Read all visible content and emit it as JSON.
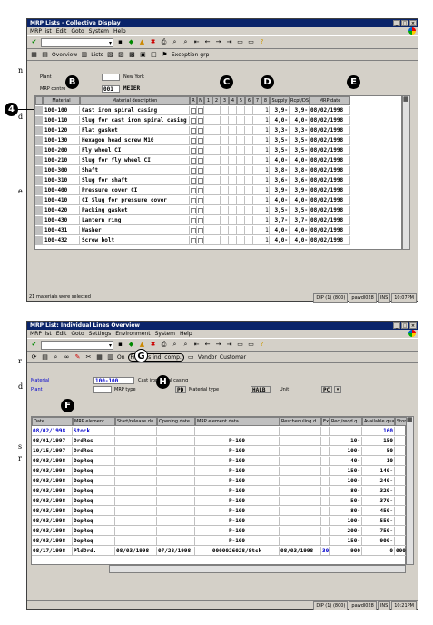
{
  "margin_letters": [
    "n",
    "d",
    "e",
    "r",
    "d",
    "s",
    "r"
  ],
  "window1": {
    "title": "MRP Lists - Collective Display",
    "menu": [
      "MRP list",
      "Edit",
      "Goto",
      "System",
      "Help"
    ],
    "app_toolbar": [
      "Overview",
      "Lists",
      "Exception grp"
    ],
    "header_fields": {
      "plant_label": "Plant",
      "plant_value": "3000",
      "plant_name": "New York",
      "controller_label": "MRP contro",
      "controller_value": "001",
      "controller_name": "MEIER"
    },
    "columns": [
      "Material",
      "Material description",
      "R",
      "N",
      "1",
      "2",
      "3",
      "4",
      "5",
      "6",
      "7",
      "8",
      "Supply",
      "Rcpt/DS",
      "MRP date"
    ],
    "rows": [
      {
        "material": "100-100",
        "description": "Cast iron spiral casing",
        "n": "1",
        "supply": "3,9-",
        "rcpt": "3,9-",
        "date": "08/02/1998"
      },
      {
        "material": "100-110",
        "description": "Slug for cast iron spiral casing",
        "n": "1",
        "supply": "4,0-",
        "rcpt": "4,0-",
        "date": "08/02/1998"
      },
      {
        "material": "100-120",
        "description": "Flat gasket",
        "n": "1",
        "supply": "3,3-",
        "rcpt": "3,3-",
        "date": "08/02/1998"
      },
      {
        "material": "100-130",
        "description": "Hexagon head screw M10",
        "n": "1",
        "supply": "3,5-",
        "rcpt": "3,5-",
        "date": "08/02/1998"
      },
      {
        "material": "100-200",
        "description": "Fly wheel CI",
        "n": "1",
        "supply": "3,5-",
        "rcpt": "3,5-",
        "date": "08/02/1998"
      },
      {
        "material": "100-210",
        "description": "Slug for fly wheel CI",
        "n": "1",
        "supply": "4,0-",
        "rcpt": "4,0-",
        "date": "08/02/1998"
      },
      {
        "material": "100-300",
        "description": "Shaft",
        "n": "1",
        "supply": "3,8-",
        "rcpt": "3,8-",
        "date": "08/02/1998"
      },
      {
        "material": "100-310",
        "description": "Slug for shaft",
        "n": "1",
        "supply": "3,6-",
        "rcpt": "3,6-",
        "date": "08/02/1998"
      },
      {
        "material": "100-400",
        "description": "Pressure cover CI",
        "n": "1",
        "supply": "3,9-",
        "rcpt": "3,9-",
        "date": "08/02/1998"
      },
      {
        "material": "100-410",
        "description": "CI Slug for pressure cover",
        "n": "1",
        "supply": "4,0-",
        "rcpt": "4,0-",
        "date": "08/02/1998"
      },
      {
        "material": "100-420",
        "description": "Packing gasket",
        "n": "1",
        "supply": "3,5-",
        "rcpt": "3,5-",
        "date": "08/02/1998"
      },
      {
        "material": "100-430",
        "description": "Lantern ring",
        "n": "1",
        "supply": "3,7-",
        "rcpt": "3,7-",
        "date": "08/02/1998"
      },
      {
        "material": "100-431",
        "description": "Washer",
        "n": "1",
        "supply": "4,0-",
        "rcpt": "4,0-",
        "date": "08/02/1998"
      },
      {
        "material": "100-432",
        "description": "Screw bolt",
        "n": "1",
        "supply": "4,0-",
        "rcpt": "4,0-",
        "date": "08/02/1998"
      }
    ],
    "status_msg": "21 materials were selected",
    "status_cells": [
      "DIP (1) (800)",
      "pawdl028",
      "INS",
      "10:07PM"
    ]
  },
  "window2": {
    "title": "MRP List: Individual Lines Overview",
    "menu": [
      "MRP list",
      "Edit",
      "Goto",
      "Settings",
      "Environment",
      "System",
      "Help"
    ],
    "app_toolbar": [
      "On",
      "Process ind. comp.",
      "Vendor",
      "Customer"
    ],
    "fields": {
      "material_label": "Material",
      "material_value": "100-100",
      "material_desc": "Cast iron spiral casing",
      "plant_label": "Plant",
      "plant_value": "3000",
      "mrp_type_label": "MRP type",
      "mrp_type_value": "PD",
      "mat_type_label": "Material type",
      "mat_type_value": "HALB",
      "unit_label": "Unit",
      "unit_value": "PC"
    },
    "columns": [
      "Date",
      "MRP element",
      "Start/release da",
      "Opening date",
      "MRP element data",
      "Rescheduling d",
      "Ex",
      "Rec./reqd q",
      "Available qua",
      "Stora"
    ],
    "rows": [
      {
        "date": "08/02/1998",
        "elem": "Stock",
        "start": "",
        "open": "",
        "data": "",
        "resched": "",
        "ex": "",
        "req": "",
        "avail": "160",
        "stor": ""
      },
      {
        "date": "08/01/1997",
        "elem": "OrdRes",
        "start": "",
        "open": "",
        "data": "P-100",
        "resched": "",
        "ex": "",
        "req": "10-",
        "avail": "150",
        "stor": ""
      },
      {
        "date": "10/15/1997",
        "elem": "OrdRes",
        "start": "",
        "open": "",
        "data": "P-100",
        "resched": "",
        "ex": "",
        "req": "100-",
        "avail": "50",
        "stor": ""
      },
      {
        "date": "08/03/1998",
        "elem": "DepReq",
        "start": "",
        "open": "",
        "data": "P-100",
        "resched": "",
        "ex": "",
        "req": "40-",
        "avail": "10",
        "stor": ""
      },
      {
        "date": "08/03/1998",
        "elem": "DepReq",
        "start": "",
        "open": "",
        "data": "P-100",
        "resched": "",
        "ex": "",
        "req": "150-",
        "avail": "140-",
        "stor": ""
      },
      {
        "date": "08/03/1998",
        "elem": "DepReq",
        "start": "",
        "open": "",
        "data": "P-100",
        "resched": "",
        "ex": "",
        "req": "100-",
        "avail": "240-",
        "stor": ""
      },
      {
        "date": "08/03/1998",
        "elem": "DepReq",
        "start": "",
        "open": "",
        "data": "P-100",
        "resched": "",
        "ex": "",
        "req": "80-",
        "avail": "320-",
        "stor": ""
      },
      {
        "date": "08/03/1998",
        "elem": "DepReq",
        "start": "",
        "open": "",
        "data": "P-100",
        "resched": "",
        "ex": "",
        "req": "50-",
        "avail": "370-",
        "stor": ""
      },
      {
        "date": "08/03/1998",
        "elem": "DepReq",
        "start": "",
        "open": "",
        "data": "P-100",
        "resched": "",
        "ex": "",
        "req": "80-",
        "avail": "450-",
        "stor": ""
      },
      {
        "date": "08/03/1998",
        "elem": "DepReq",
        "start": "",
        "open": "",
        "data": "P-100",
        "resched": "",
        "ex": "",
        "req": "100-",
        "avail": "550-",
        "stor": ""
      },
      {
        "date": "08/03/1998",
        "elem": "DepReq",
        "start": "",
        "open": "",
        "data": "P-100",
        "resched": "",
        "ex": "",
        "req": "200-",
        "avail": "750-",
        "stor": ""
      },
      {
        "date": "08/03/1998",
        "elem": "DepReq",
        "start": "",
        "open": "",
        "data": "P-100",
        "resched": "",
        "ex": "",
        "req": "150-",
        "avail": "900-",
        "stor": ""
      },
      {
        "date": "08/17/1998",
        "elem": "PldOrd.",
        "start": "08/03/1998",
        "open": "07/28/1998",
        "data": "0000026028/Stck",
        "resched": "08/03/1998",
        "ex": "30",
        "req": "900",
        "avail": "0",
        "stor": "0001"
      }
    ],
    "status_cells": [
      "DIP (1) (800)",
      "pawdl028",
      "INS",
      "10:21PM"
    ]
  },
  "callouts": {
    "b": "B",
    "c": "C",
    "d": "D",
    "e": "E",
    "four": "4",
    "f": "F",
    "g": "G",
    "h": "H"
  }
}
